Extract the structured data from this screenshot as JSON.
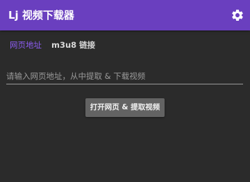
{
  "app": {
    "title": "Lj 视频下载器",
    "settings_icon": "gear-icon"
  },
  "tabs": [
    {
      "label": "网页地址",
      "active": true
    },
    {
      "label": "m3u8 链接",
      "active": false
    }
  ],
  "url_input": {
    "value": "",
    "placeholder": "请输入网页地址，从中提取 & 下载视频"
  },
  "extract_button": {
    "label": "打开网页 & 提取视频"
  },
  "colors": {
    "titlebar": "#6a3fbf",
    "active_tab": "#8c5cf0",
    "background": "#2b2b2b",
    "button": "#636363"
  }
}
